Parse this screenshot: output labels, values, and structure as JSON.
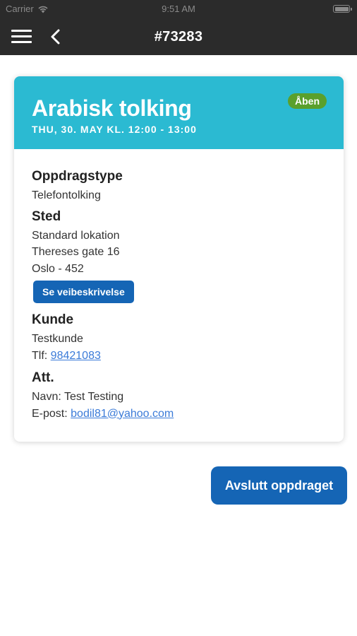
{
  "statusbar": {
    "carrier": "Carrier",
    "time": "9:51 AM"
  },
  "navbar": {
    "title": "#73283"
  },
  "card": {
    "title": "Arabisk tolking",
    "date": "THU, 30. MAY KL. 12:00 - 13:00",
    "status": "Åben",
    "header_color": "#2bbad2",
    "assignment_type": {
      "heading": "Oppdragstype",
      "value": "Telefontolking"
    },
    "location": {
      "heading": "Sted",
      "name": "Standard lokation",
      "street": "Thereses gate 16",
      "city": "Oslo - 452",
      "route_button": "Se veibeskrivelse"
    },
    "customer": {
      "heading": "Kunde",
      "name": "Testkunde",
      "phone_label": "Tlf:",
      "phone": "98421083"
    },
    "att": {
      "heading": "Att.",
      "name_label": "Navn:",
      "name": "Test Testing",
      "email_label": "E-post:",
      "email": "bodil81@yahoo.com"
    }
  },
  "actions": {
    "finish_label": "Avslutt oppdraget"
  },
  "colors": {
    "primary": "#1565b5",
    "status_green": "#5aa02c",
    "navbar": "#2b2b2b",
    "link": "#3b7bd8"
  }
}
